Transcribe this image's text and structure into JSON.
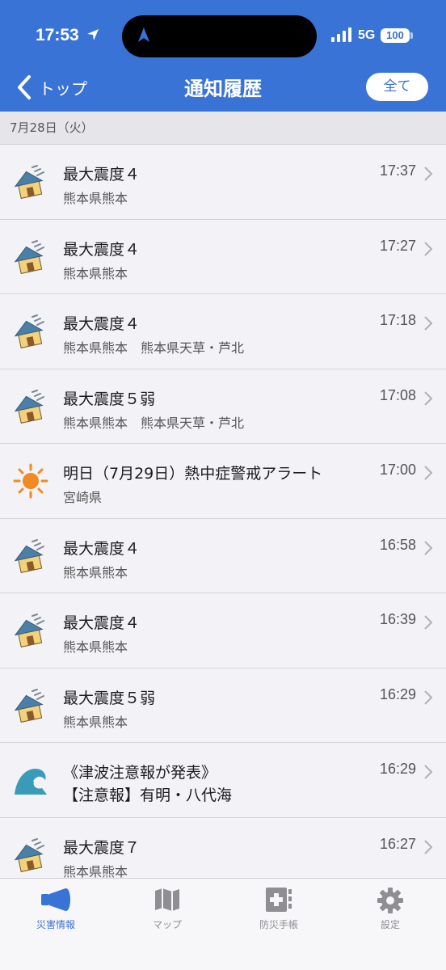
{
  "status": {
    "time": "17:53",
    "network": "5G",
    "battery": "100"
  },
  "nav": {
    "back_label": "トップ",
    "title": "通知履歴",
    "all_button": "全て"
  },
  "section": {
    "date": "7月28日（火）"
  },
  "items": [
    {
      "icon": "earthquake-house-icon",
      "title": "最大震度４",
      "subtitle": "熊本県熊本",
      "time": "17:37"
    },
    {
      "icon": "earthquake-house-icon",
      "title": "最大震度４",
      "subtitle": "熊本県熊本",
      "time": "17:27"
    },
    {
      "icon": "earthquake-house-icon",
      "title": "最大震度４",
      "subtitle": "熊本県熊本　熊本県天草・芦北",
      "time": "17:18"
    },
    {
      "icon": "earthquake-house-icon",
      "title": "最大震度５弱",
      "subtitle": "熊本県熊本　熊本県天草・芦北",
      "time": "17:08"
    },
    {
      "icon": "sun-icon",
      "title": "明日（7月29日）熱中症警戒アラート",
      "subtitle": "宮崎県",
      "time": "17:00"
    },
    {
      "icon": "earthquake-house-icon",
      "title": "最大震度４",
      "subtitle": "熊本県熊本",
      "time": "16:58"
    },
    {
      "icon": "earthquake-house-icon",
      "title": "最大震度４",
      "subtitle": "熊本県熊本",
      "time": "16:39"
    },
    {
      "icon": "earthquake-house-icon",
      "title": "最大震度５弱",
      "subtitle": "熊本県熊本",
      "time": "16:29"
    },
    {
      "icon": "tsunami-wave-icon",
      "title": "《津波注意報が発表》",
      "subtitle": "【注意報】有明・八代海",
      "time": "16:29"
    },
    {
      "icon": "earthquake-house-icon",
      "title": "最大震度７",
      "subtitle": "熊本県熊本",
      "time": "16:27"
    }
  ],
  "tabs": [
    {
      "label": "災害情報",
      "icon": "megaphone-icon",
      "active": true
    },
    {
      "label": "マップ",
      "icon": "map-icon",
      "active": false
    },
    {
      "label": "防災手帳",
      "icon": "first-aid-notebook-icon",
      "active": false
    },
    {
      "label": "設定",
      "icon": "gear-icon",
      "active": false
    }
  ],
  "colors": {
    "accent": "#3a73d6",
    "header": "#3a73d6",
    "background": "#f2f2f7"
  }
}
